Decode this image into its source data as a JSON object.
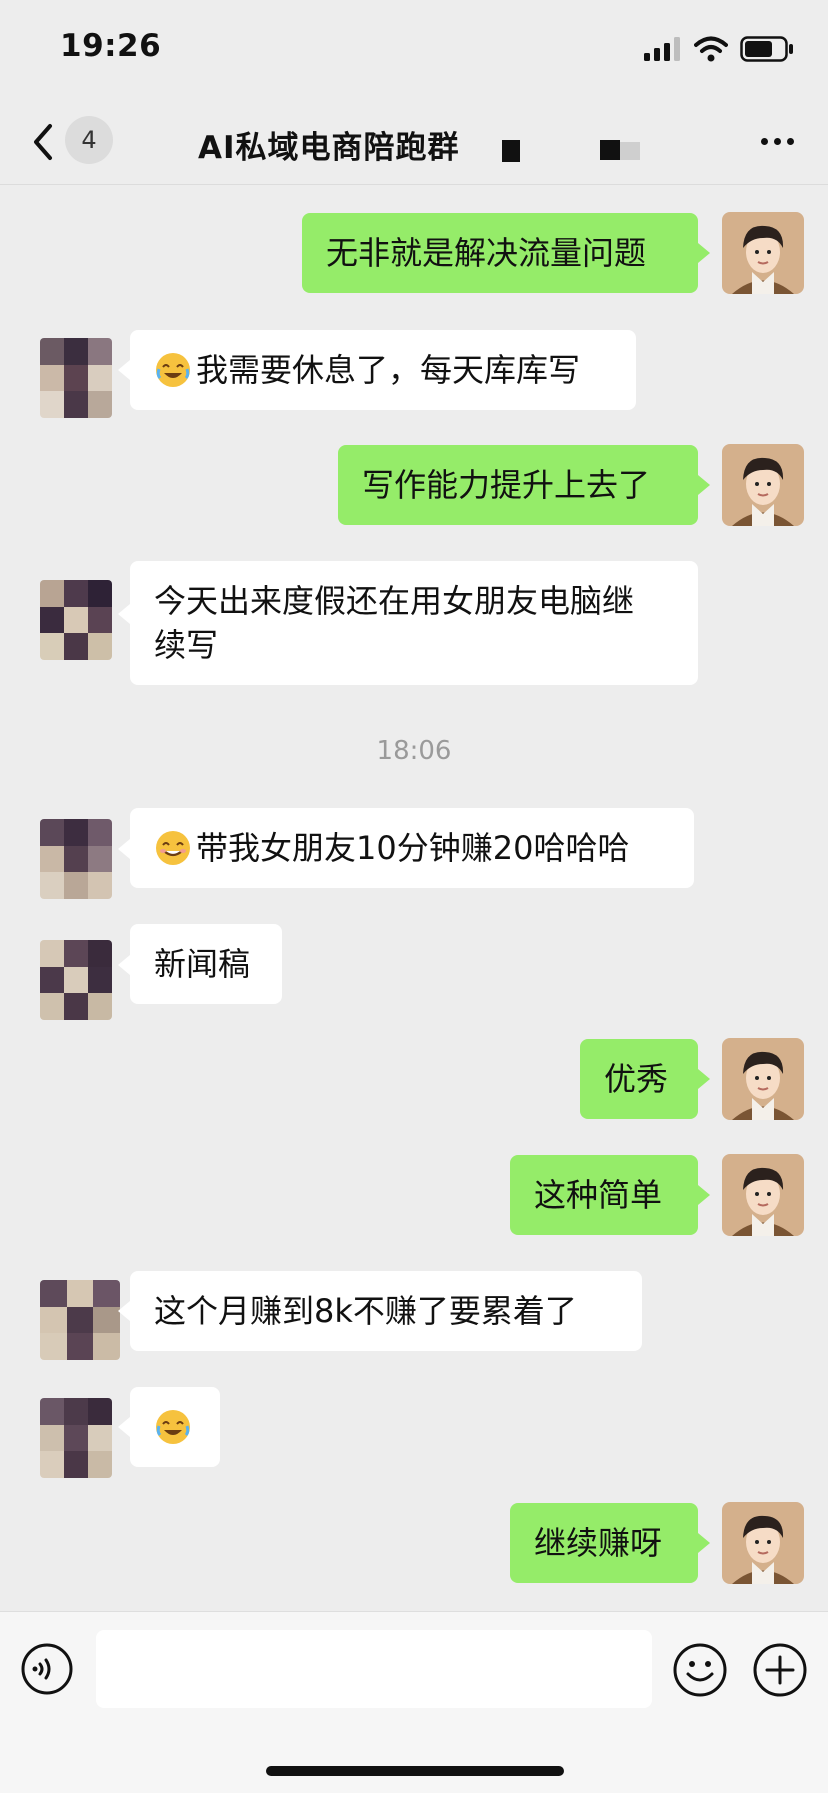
{
  "status": {
    "time": "19:26"
  },
  "header": {
    "title": "AI私域电商陪跑群",
    "unread_count": "4"
  },
  "messages": [
    {
      "side": "self",
      "text": "无非就是解决流量问题"
    },
    {
      "side": "other",
      "emoji": "crying-laughing",
      "text": "我需要休息了，每天库库写"
    },
    {
      "side": "self",
      "text": "写作能力提升上去了"
    },
    {
      "side": "other",
      "text_line1": "今天出来度假还在用女朋友电脑继",
      "text_line2": "续写"
    },
    {
      "timestamp": "18:06"
    },
    {
      "side": "other",
      "emoji": "grinning",
      "text": "带我女朋友10分钟赚20哈哈哈"
    },
    {
      "side": "other",
      "text": "新闻稿"
    },
    {
      "side": "self",
      "text": "优秀"
    },
    {
      "side": "self",
      "text": "这种简单"
    },
    {
      "side": "other",
      "text": "这个月赚到8k不赚了要累着了"
    },
    {
      "side": "other",
      "emoji": "crying-laughing"
    },
    {
      "side": "self",
      "text": "继续赚呀"
    }
  ],
  "input": {
    "value": ""
  },
  "icons": {
    "back": "back-chevron-icon",
    "more": "more-icon",
    "voice": "voice-icon",
    "emoji": "emoji-smile-icon",
    "plus": "plus-icon"
  },
  "colors": {
    "self_bubble": "#95ec69",
    "other_bubble": "#ffffff",
    "background": "#ededed"
  }
}
